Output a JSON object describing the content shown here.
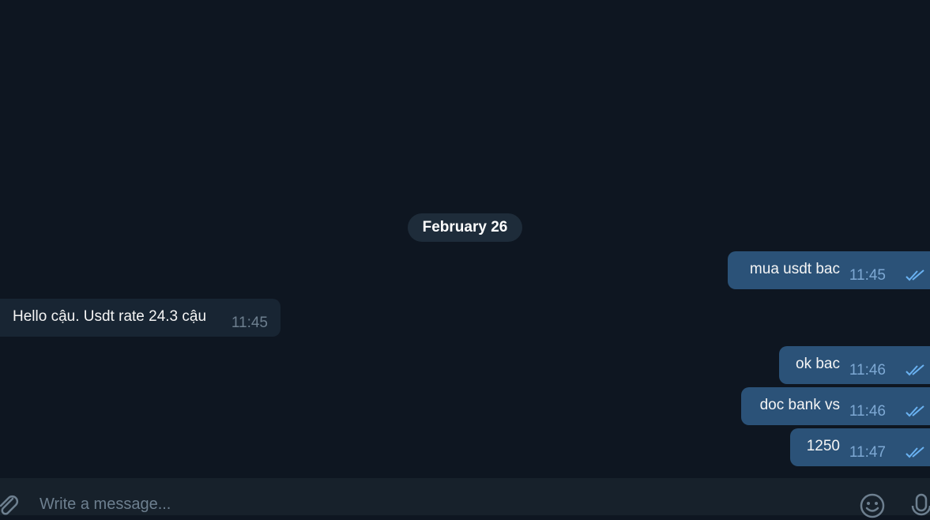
{
  "date_separator": "February 26",
  "messages": [
    {
      "direction": "out",
      "text": "mua usdt bac",
      "time": "11:45",
      "status": "read"
    },
    {
      "direction": "in",
      "text": "Hello cậu. Usdt rate 24.3 cậu",
      "time": "11:45"
    },
    {
      "direction": "out",
      "text": "ok bac",
      "time": "11:46",
      "status": "read"
    },
    {
      "direction": "out",
      "text": "doc bank vs",
      "time": "11:46",
      "status": "read"
    },
    {
      "direction": "out",
      "text": "1250",
      "time": "11:47",
      "status": "read"
    }
  ],
  "composer": {
    "placeholder": "Write a message...",
    "attach_icon": "paperclip-icon",
    "emoji_icon": "smiley-icon",
    "mic_icon": "microphone-icon"
  },
  "colors": {
    "background": "#0e1621",
    "outgoing_bubble": "#2b5278",
    "incoming_bubble": "#182533",
    "date_pill": "#1e2c3a",
    "composer": "#17212b",
    "read_check": "#6ab2f2"
  }
}
